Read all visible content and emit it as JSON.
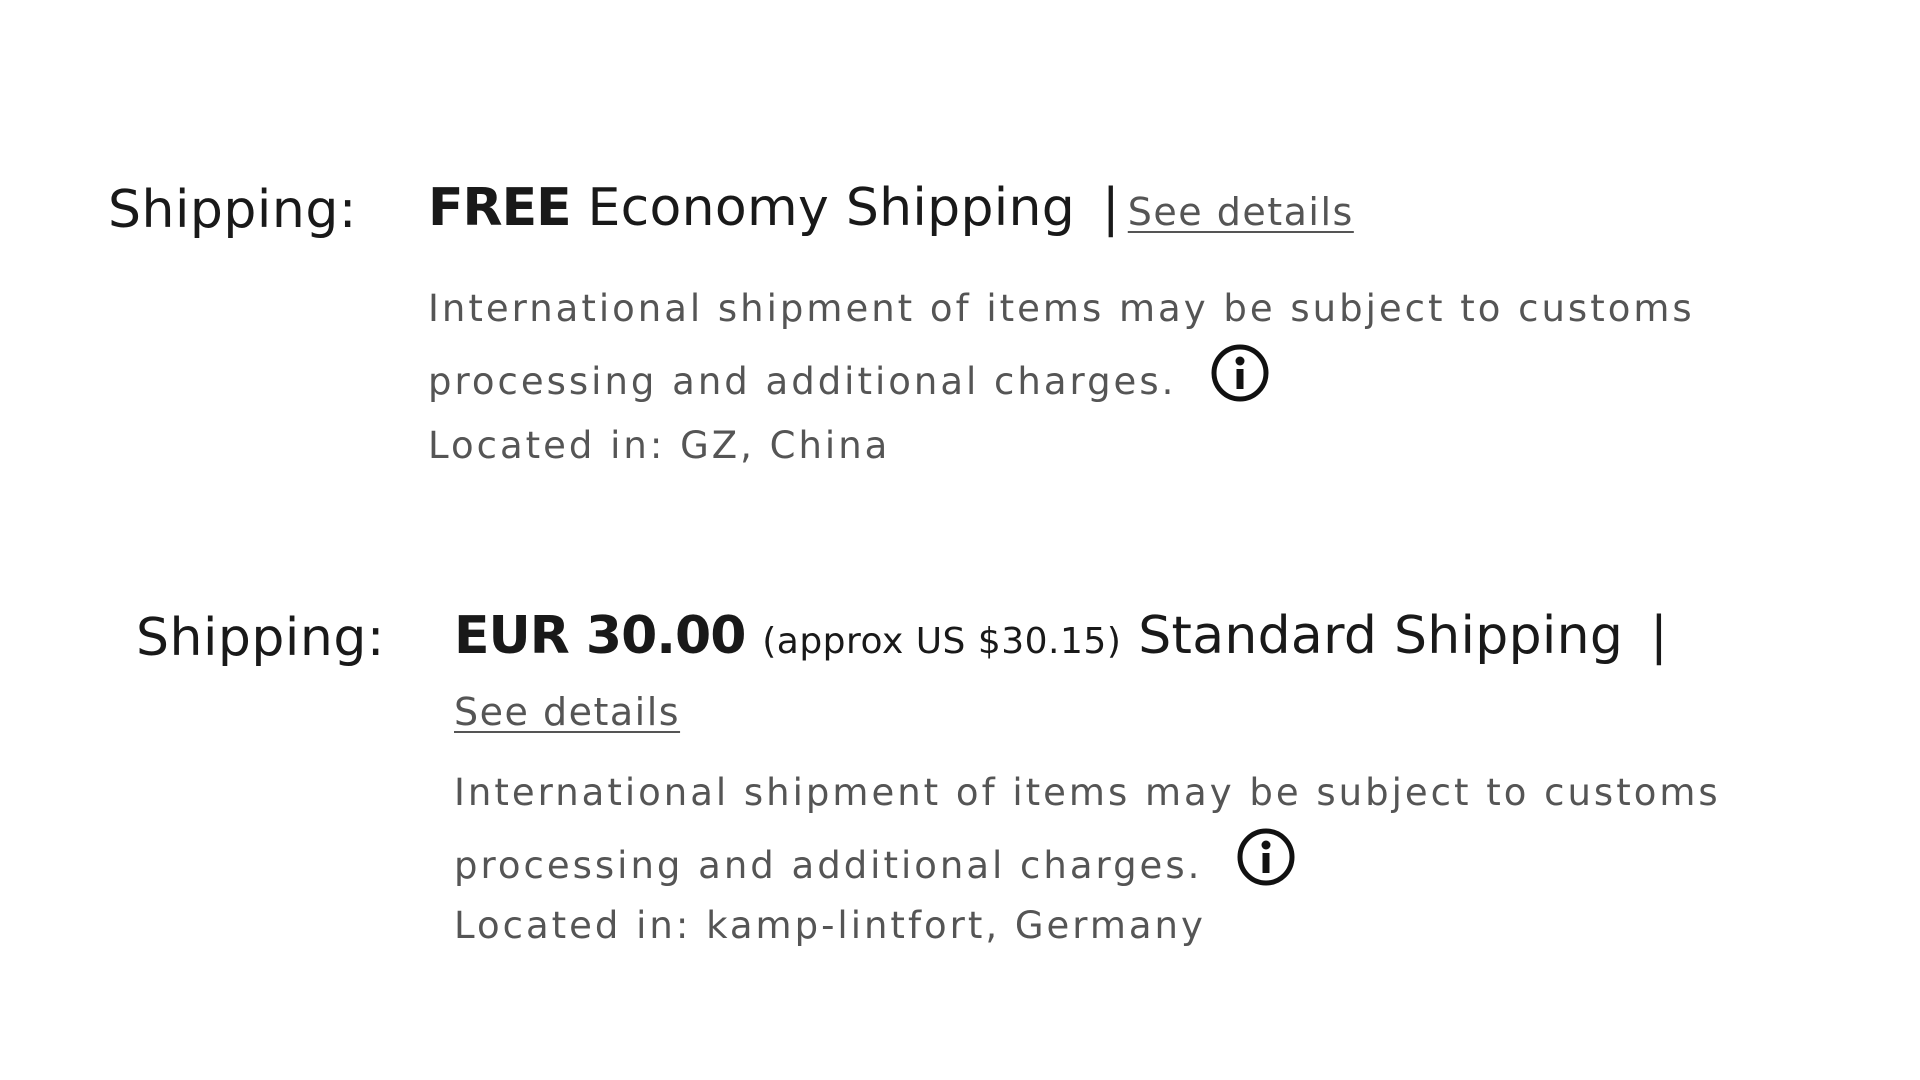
{
  "shipping_options": [
    {
      "label": "Shipping:",
      "price": "FREE",
      "approx": "",
      "service": "Economy Shipping",
      "separator": "|",
      "details_link": "See details",
      "note": "International shipment of items may be subject to customs processing and additional charges.",
      "info_icon": "info-circle-icon",
      "location": "Located in: GZ, China"
    },
    {
      "label": "Shipping:",
      "price": "EUR 30.00",
      "approx": "(approx US $30.15)",
      "service": "Standard Shipping",
      "separator": "|",
      "details_link": "See details",
      "note": "International shipment of items may be subject to customs processing and additional charges.",
      "info_icon": "info-circle-icon",
      "location": "Located in: kamp-lintfort, Germany"
    }
  ]
}
